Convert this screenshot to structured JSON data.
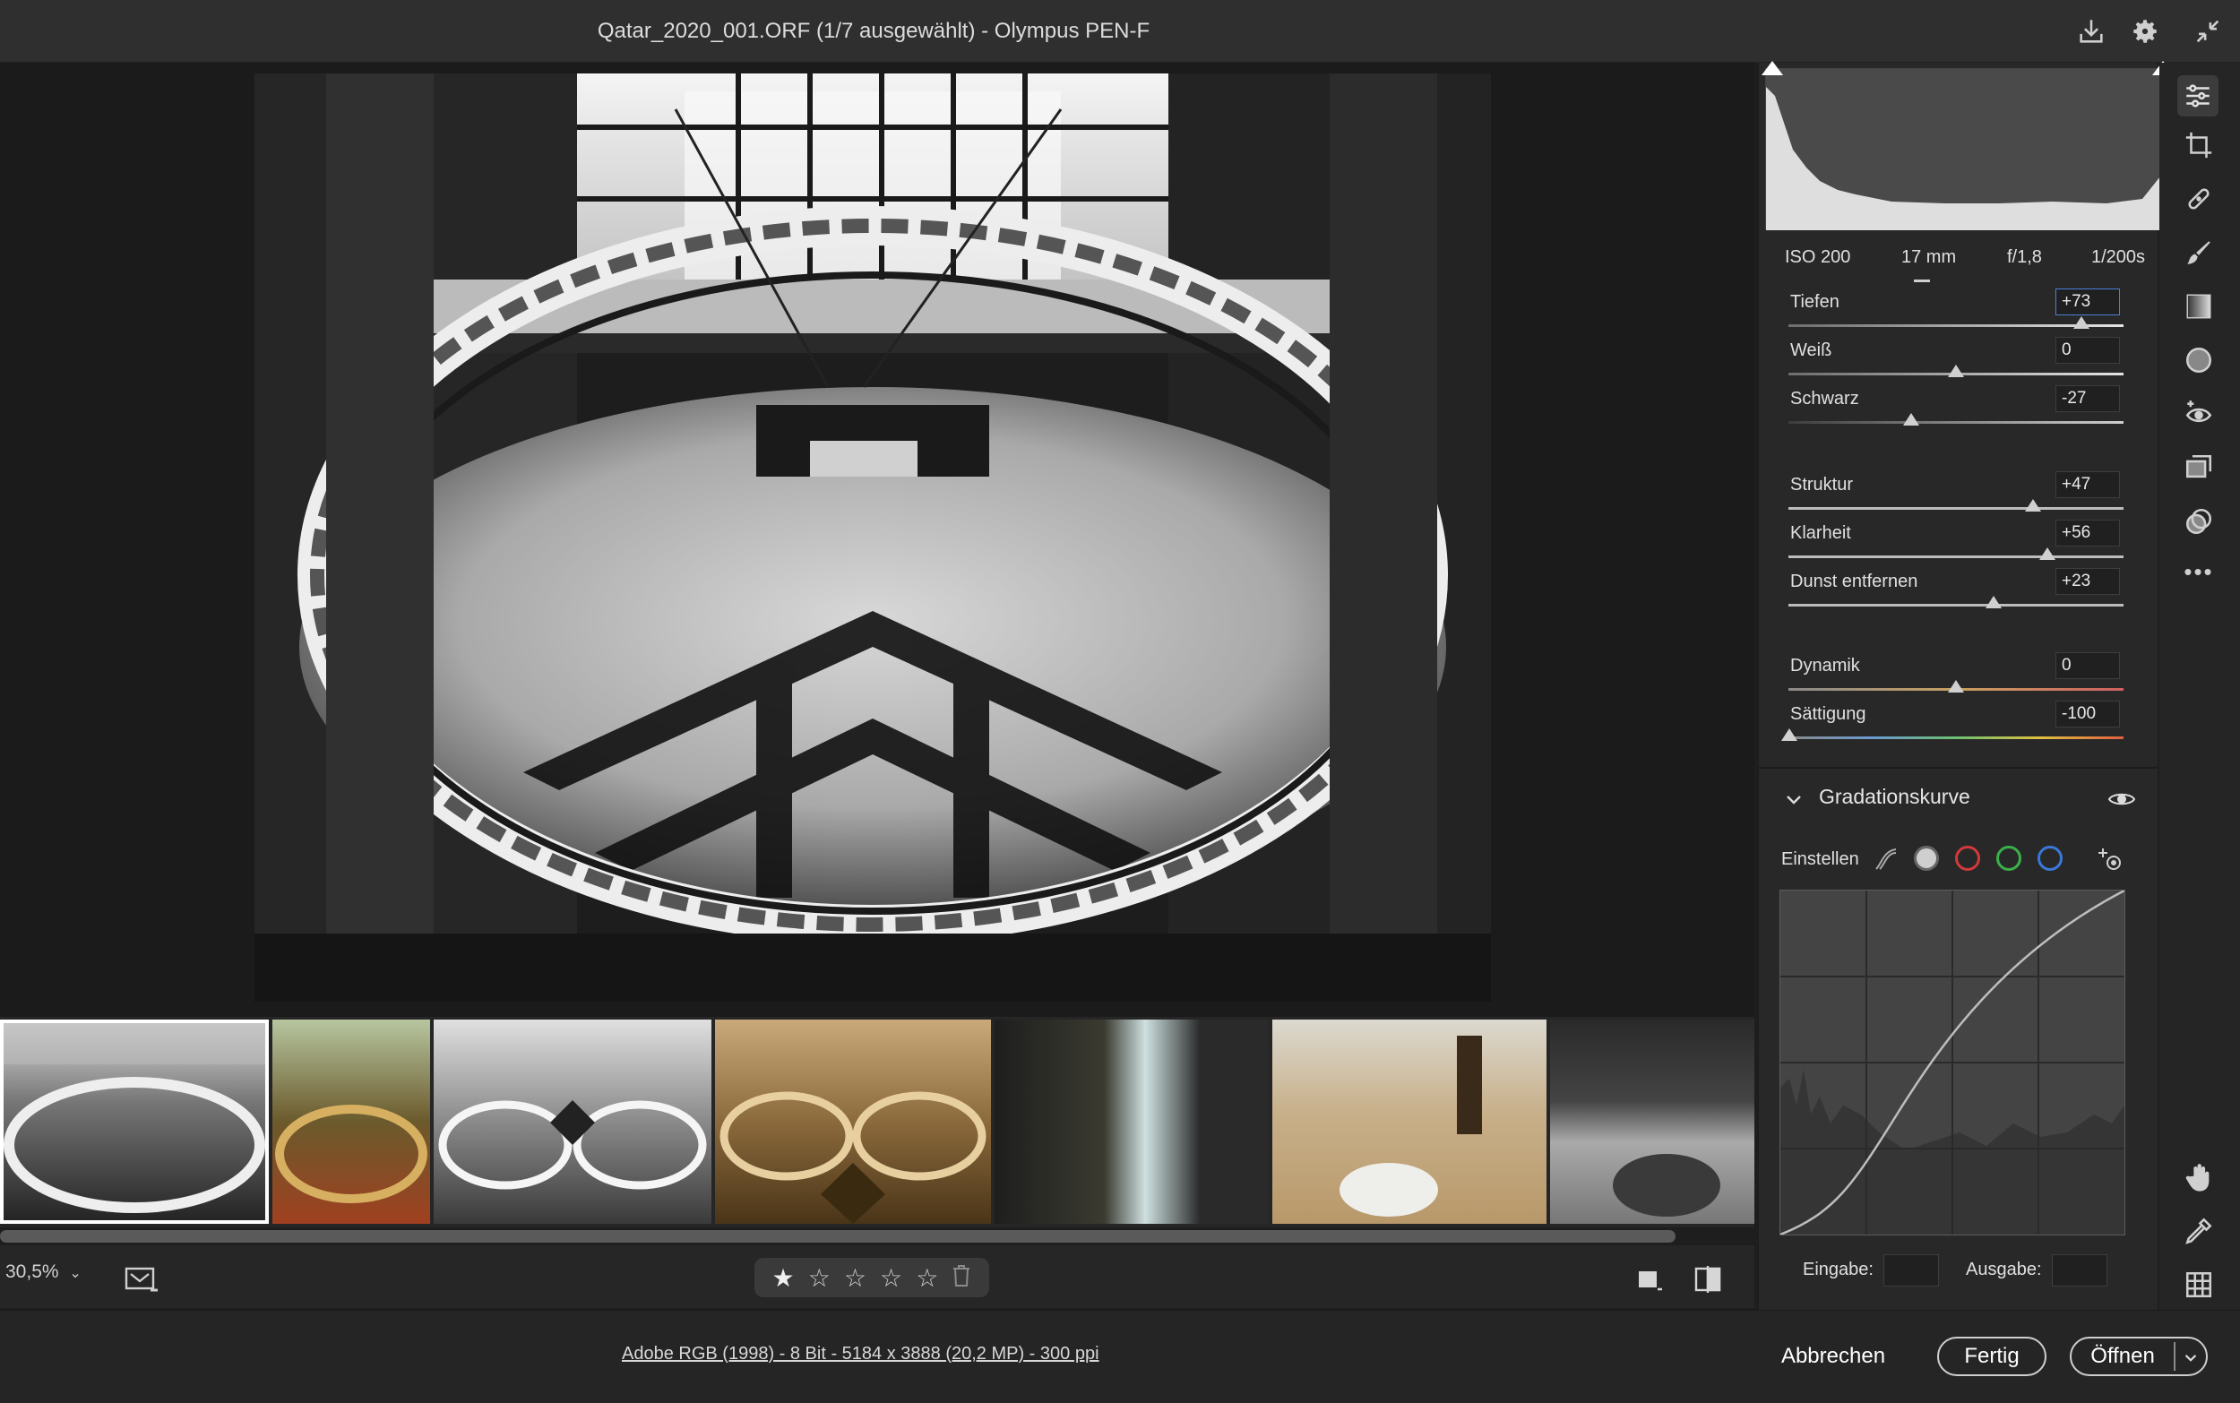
{
  "window": {
    "title": "Qatar_2020_001.ORF (1/7 ausgewählt) - Olympus PEN-F"
  },
  "exif": {
    "iso": "ISO 200",
    "focal": "17 mm",
    "aperture": "f/1,8",
    "shutter": "1/200s"
  },
  "sliders": [
    {
      "label": "Tiefen",
      "value": "+73"
    },
    {
      "label": "Weiß",
      "value": "0"
    },
    {
      "label": "Schwarz",
      "value": "-27"
    },
    {
      "label": "Struktur",
      "value": "+47"
    },
    {
      "label": "Klarheit",
      "value": "+56"
    },
    {
      "label": "Dunst entfernen",
      "value": "+23"
    },
    {
      "label": "Dynamik",
      "value": "0"
    },
    {
      "label": "Sättigung",
      "value": "-100"
    }
  ],
  "curve": {
    "section_title": "Gradationskurve",
    "adjust_label": "Einstellen",
    "input_label": "Eingabe:",
    "output_label": "Ausgabe:"
  },
  "bottom": {
    "zoom": "30,5%",
    "rating_filled": 1,
    "rating_total": 5
  },
  "footer": {
    "image_info": "Adobe RGB (1998) - 8 Bit - 5184 x 3888 (20,2 MP) - 300 ppi",
    "cancel_label": "Abbrechen",
    "done_label": "Fertig",
    "open_label": "Öffnen"
  },
  "colors": {
    "accent_blue": "#4a7fd6",
    "panel_bg": "#282828"
  }
}
